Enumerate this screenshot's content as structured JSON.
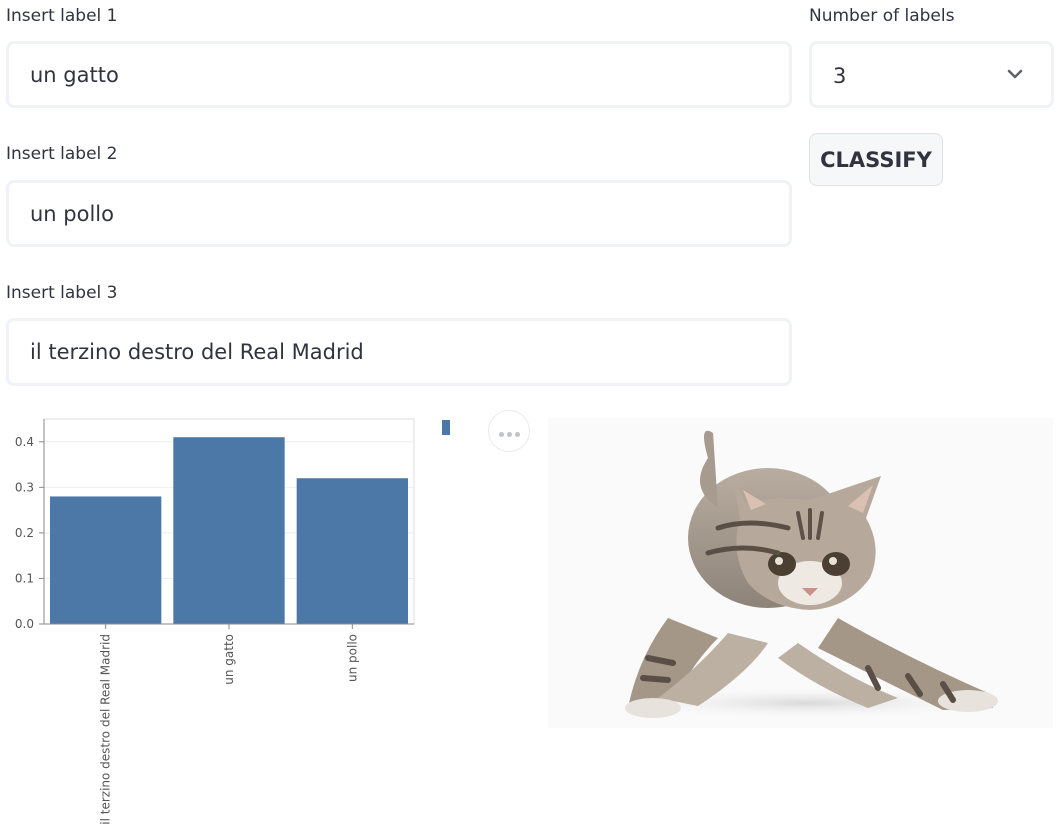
{
  "form": {
    "label1": {
      "label": "Insert label 1",
      "value": "un gatto"
    },
    "label2": {
      "label": "Insert label 2",
      "value": "un pollo"
    },
    "label3": {
      "label": "Insert label 3",
      "value": "il terzino destro del Real Madrid"
    },
    "num_labels": {
      "label": "Number of labels",
      "value": "3"
    },
    "classify_label": "CLASSIFY"
  },
  "icons": {
    "dropdown": "chevron-down-icon",
    "more": "more-horizontal-icon",
    "expand": "expand-icon"
  },
  "image": {
    "subject": "kitten"
  },
  "colors": {
    "bar": "#4c78a8",
    "accent": "#31333f",
    "input_border": "#f0f2f6"
  },
  "chart_data": {
    "type": "bar",
    "categories": [
      "il terzino destro del Real Madrid",
      "un gatto",
      "un pollo"
    ],
    "series": [
      {
        "name": "0",
        "values": [
          0.28,
          0.41,
          0.32
        ]
      }
    ],
    "ylim": [
      0,
      0.45
    ],
    "yticks": [
      "0.0",
      "0.1",
      "0.2",
      "0.3",
      "0.4"
    ],
    "xlabel": "",
    "ylabel": "",
    "title": "",
    "legend": "top-right",
    "grid": true
  }
}
